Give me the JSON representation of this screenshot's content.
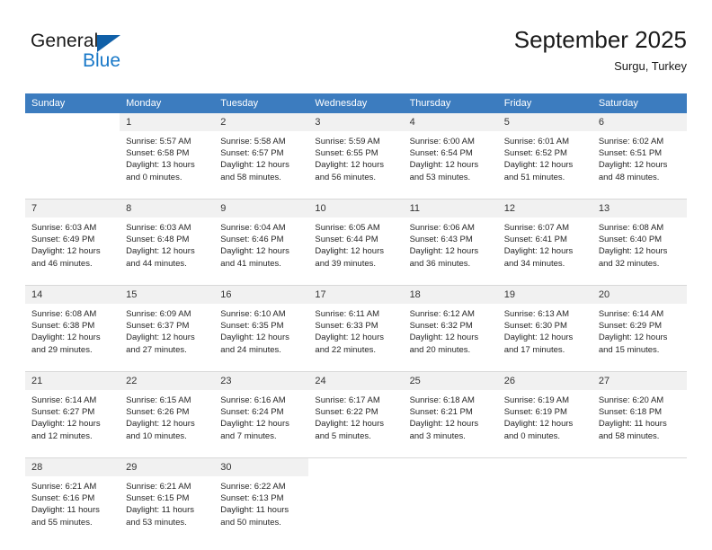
{
  "brand": {
    "name_part1": "General",
    "name_part2": "Blue",
    "triangle_icon": "triangle-icon",
    "accent_color": "#1878c8",
    "triangle_color": "#1060a8"
  },
  "header": {
    "title": "September 2025",
    "subtitle": "Surgu, Turkey",
    "header_bg_color": "#3c7cbf",
    "daynum_bg_color": "#f1f1f1"
  },
  "weekday_headers": [
    "Sunday",
    "Monday",
    "Tuesday",
    "Wednesday",
    "Thursday",
    "Friday",
    "Saturday"
  ],
  "weeks": [
    [
      {
        "day": "",
        "lines": []
      },
      {
        "day": "1",
        "lines": [
          "Sunrise: 5:57 AM",
          "Sunset: 6:58 PM",
          "Daylight: 13 hours",
          "and 0 minutes."
        ]
      },
      {
        "day": "2",
        "lines": [
          "Sunrise: 5:58 AM",
          "Sunset: 6:57 PM",
          "Daylight: 12 hours",
          "and 58 minutes."
        ]
      },
      {
        "day": "3",
        "lines": [
          "Sunrise: 5:59 AM",
          "Sunset: 6:55 PM",
          "Daylight: 12 hours",
          "and 56 minutes."
        ]
      },
      {
        "day": "4",
        "lines": [
          "Sunrise: 6:00 AM",
          "Sunset: 6:54 PM",
          "Daylight: 12 hours",
          "and 53 minutes."
        ]
      },
      {
        "day": "5",
        "lines": [
          "Sunrise: 6:01 AM",
          "Sunset: 6:52 PM",
          "Daylight: 12 hours",
          "and 51 minutes."
        ]
      },
      {
        "day": "6",
        "lines": [
          "Sunrise: 6:02 AM",
          "Sunset: 6:51 PM",
          "Daylight: 12 hours",
          "and 48 minutes."
        ]
      }
    ],
    [
      {
        "day": "7",
        "lines": [
          "Sunrise: 6:03 AM",
          "Sunset: 6:49 PM",
          "Daylight: 12 hours",
          "and 46 minutes."
        ]
      },
      {
        "day": "8",
        "lines": [
          "Sunrise: 6:03 AM",
          "Sunset: 6:48 PM",
          "Daylight: 12 hours",
          "and 44 minutes."
        ]
      },
      {
        "day": "9",
        "lines": [
          "Sunrise: 6:04 AM",
          "Sunset: 6:46 PM",
          "Daylight: 12 hours",
          "and 41 minutes."
        ]
      },
      {
        "day": "10",
        "lines": [
          "Sunrise: 6:05 AM",
          "Sunset: 6:44 PM",
          "Daylight: 12 hours",
          "and 39 minutes."
        ]
      },
      {
        "day": "11",
        "lines": [
          "Sunrise: 6:06 AM",
          "Sunset: 6:43 PM",
          "Daylight: 12 hours",
          "and 36 minutes."
        ]
      },
      {
        "day": "12",
        "lines": [
          "Sunrise: 6:07 AM",
          "Sunset: 6:41 PM",
          "Daylight: 12 hours",
          "and 34 minutes."
        ]
      },
      {
        "day": "13",
        "lines": [
          "Sunrise: 6:08 AM",
          "Sunset: 6:40 PM",
          "Daylight: 12 hours",
          "and 32 minutes."
        ]
      }
    ],
    [
      {
        "day": "14",
        "lines": [
          "Sunrise: 6:08 AM",
          "Sunset: 6:38 PM",
          "Daylight: 12 hours",
          "and 29 minutes."
        ]
      },
      {
        "day": "15",
        "lines": [
          "Sunrise: 6:09 AM",
          "Sunset: 6:37 PM",
          "Daylight: 12 hours",
          "and 27 minutes."
        ]
      },
      {
        "day": "16",
        "lines": [
          "Sunrise: 6:10 AM",
          "Sunset: 6:35 PM",
          "Daylight: 12 hours",
          "and 24 minutes."
        ]
      },
      {
        "day": "17",
        "lines": [
          "Sunrise: 6:11 AM",
          "Sunset: 6:33 PM",
          "Daylight: 12 hours",
          "and 22 minutes."
        ]
      },
      {
        "day": "18",
        "lines": [
          "Sunrise: 6:12 AM",
          "Sunset: 6:32 PM",
          "Daylight: 12 hours",
          "and 20 minutes."
        ]
      },
      {
        "day": "19",
        "lines": [
          "Sunrise: 6:13 AM",
          "Sunset: 6:30 PM",
          "Daylight: 12 hours",
          "and 17 minutes."
        ]
      },
      {
        "day": "20",
        "lines": [
          "Sunrise: 6:14 AM",
          "Sunset: 6:29 PM",
          "Daylight: 12 hours",
          "and 15 minutes."
        ]
      }
    ],
    [
      {
        "day": "21",
        "lines": [
          "Sunrise: 6:14 AM",
          "Sunset: 6:27 PM",
          "Daylight: 12 hours",
          "and 12 minutes."
        ]
      },
      {
        "day": "22",
        "lines": [
          "Sunrise: 6:15 AM",
          "Sunset: 6:26 PM",
          "Daylight: 12 hours",
          "and 10 minutes."
        ]
      },
      {
        "day": "23",
        "lines": [
          "Sunrise: 6:16 AM",
          "Sunset: 6:24 PM",
          "Daylight: 12 hours",
          "and 7 minutes."
        ]
      },
      {
        "day": "24",
        "lines": [
          "Sunrise: 6:17 AM",
          "Sunset: 6:22 PM",
          "Daylight: 12 hours",
          "and 5 minutes."
        ]
      },
      {
        "day": "25",
        "lines": [
          "Sunrise: 6:18 AM",
          "Sunset: 6:21 PM",
          "Daylight: 12 hours",
          "and 3 minutes."
        ]
      },
      {
        "day": "26",
        "lines": [
          "Sunrise: 6:19 AM",
          "Sunset: 6:19 PM",
          "Daylight: 12 hours",
          "and 0 minutes."
        ]
      },
      {
        "day": "27",
        "lines": [
          "Sunrise: 6:20 AM",
          "Sunset: 6:18 PM",
          "Daylight: 11 hours",
          "and 58 minutes."
        ]
      }
    ],
    [
      {
        "day": "28",
        "lines": [
          "Sunrise: 6:21 AM",
          "Sunset: 6:16 PM",
          "Daylight: 11 hours",
          "and 55 minutes."
        ]
      },
      {
        "day": "29",
        "lines": [
          "Sunrise: 6:21 AM",
          "Sunset: 6:15 PM",
          "Daylight: 11 hours",
          "and 53 minutes."
        ]
      },
      {
        "day": "30",
        "lines": [
          "Sunrise: 6:22 AM",
          "Sunset: 6:13 PM",
          "Daylight: 11 hours",
          "and 50 minutes."
        ]
      },
      {
        "day": "",
        "lines": []
      },
      {
        "day": "",
        "lines": []
      },
      {
        "day": "",
        "lines": []
      },
      {
        "day": "",
        "lines": []
      }
    ]
  ]
}
